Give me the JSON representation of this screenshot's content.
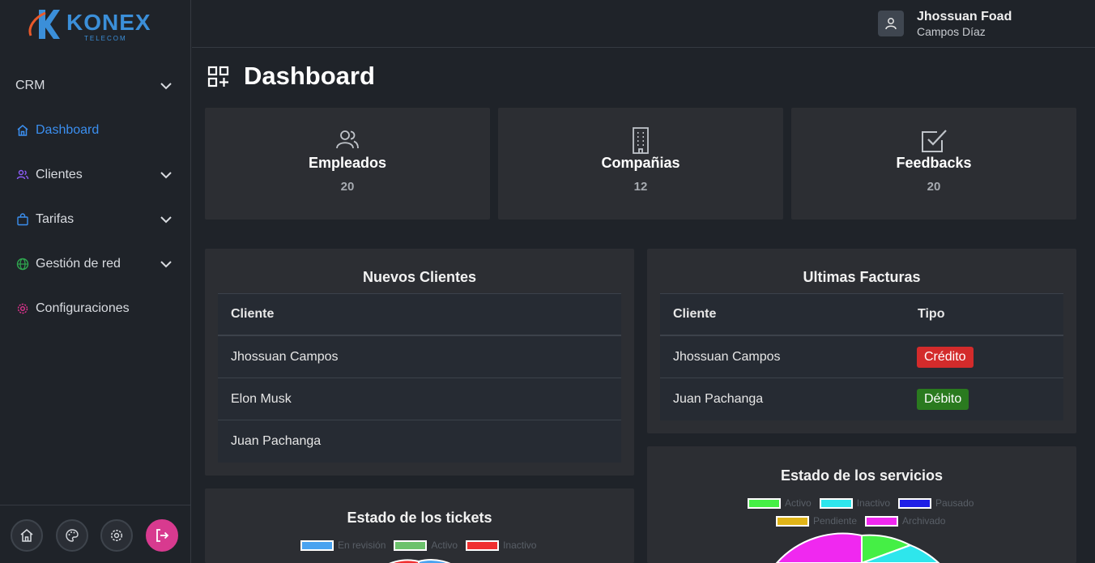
{
  "brand": {
    "name": "KONEX",
    "sub": "TELECOM"
  },
  "sidebar": {
    "items": [
      {
        "label": "CRM",
        "icon": "none",
        "has_chevron": true
      },
      {
        "label": "Dashboard",
        "icon": "home-icon",
        "active": true
      },
      {
        "label": "Clientes",
        "icon": "users-icon",
        "has_chevron": true
      },
      {
        "label": "Tarifas",
        "icon": "shopping-bag-icon",
        "has_chevron": true
      },
      {
        "label": "Gestión de red",
        "icon": "globe-icon",
        "has_chevron": true
      },
      {
        "label": "Configuraciones",
        "icon": "gear-icon"
      }
    ],
    "bottom_buttons": [
      "home-icon",
      "palette-icon",
      "gear-icon",
      "logout-icon"
    ]
  },
  "user": {
    "name": "Jhossuan Foad",
    "subtitle": "Campos Díaz"
  },
  "page": {
    "title": "Dashboard"
  },
  "stats": [
    {
      "label": "Empleados",
      "value": "20",
      "icon": "users-icon"
    },
    {
      "label": "Compañias",
      "value": "12",
      "icon": "building-icon"
    },
    {
      "label": "Feedbacks",
      "value": "20",
      "icon": "checkbox-icon"
    }
  ],
  "nuevos_clientes": {
    "title": "Nuevos Clientes",
    "header": "Cliente",
    "rows": [
      "Jhossuan Campos",
      "Elon Musk",
      "Juan Pachanga"
    ]
  },
  "ultimas_facturas": {
    "title": "Ultimas Facturas",
    "headers": [
      "Cliente",
      "Tipo"
    ],
    "rows": [
      {
        "cliente": "Jhossuan Campos",
        "tipo": "Crédito",
        "color": "#d32b2b"
      },
      {
        "cliente": "Juan Pachanga",
        "tipo": "Débito",
        "color": "#2a7a1f"
      }
    ]
  },
  "tickets": {
    "title": "Estado de los tickets",
    "legend": [
      {
        "label": "En revisión",
        "color": "#4aa3f0"
      },
      {
        "label": "Activo",
        "color": "#6cc26c"
      },
      {
        "label": "Inactivo",
        "color": "#f03030"
      }
    ]
  },
  "servicios": {
    "title": "Estado de los servicios",
    "legend": [
      {
        "label": "Activo",
        "color": "#45ef45"
      },
      {
        "label": "Inactivo",
        "color": "#2ee6ec"
      },
      {
        "label": "Pausado",
        "color": "#1f1fe6"
      },
      {
        "label": "Pendiente",
        "color": "#e0b418"
      },
      {
        "label": "Archivado",
        "color": "#f028f0"
      }
    ]
  },
  "colors": {
    "accent": "#3b8ff0",
    "logout": "#d83a8f",
    "card": "#2c2e33",
    "bg": "#1f2329"
  }
}
